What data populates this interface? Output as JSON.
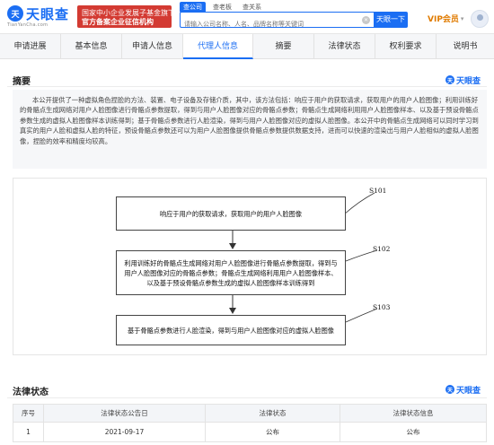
{
  "header": {
    "logo_mark": "天",
    "logo_text": "天眼查",
    "logo_sub": "TianYanCha.com",
    "gov_badge_line1": "国家中小企业发展子基金旗下",
    "gov_badge_line2": "官方备案企业征信机构",
    "search_tabs": [
      "查公司",
      "查老板",
      "查关系"
    ],
    "search_placeholder": "请输入公司名称、人名、品牌名称等关键词",
    "search_button": "天眼一下",
    "vip_label": "VIP会员",
    "vip_caret": "▾"
  },
  "tabs": [
    {
      "label": "申请进展"
    },
    {
      "label": "基本信息"
    },
    {
      "label": "申请人信息"
    },
    {
      "label": "代理人信息"
    },
    {
      "label": "摘要"
    },
    {
      "label": "法律状态"
    },
    {
      "label": "权利要求"
    },
    {
      "label": "说明书"
    }
  ],
  "abstract_section": {
    "title": "摘要",
    "brand": "天眼查",
    "text": "本公开提供了一种虚拟角色捏脸的方法、装置、电子设备及存储介质，其中，该方法包括：响应于用户的获取请求，获取用户的用户人脸图像；利用训练好的骨骼点生成网络对用户人脸图像进行骨骼点参数提取，得到与用户人脸图像对应的骨骼点参数；骨骼点生成网络利用用户人脸图像样本、以及基于预设骨骼点参数生成的虚拟人脸图像样本训练得到；基于骨骼点参数进行人脸渲染，得到与用户人脸图像对应的虚拟人脸图像。本公开中的骨骼点生成网络可以同时学习到真实的用户人脸和虚拟人脸的特征，预设骨骼点参数还可以为用户人脸图像提供骨骼点参数提供数据支持，进而可以快速的渲染出与用户人脸相似的虚拟人脸图像，捏脸的效率和精度均较高。"
  },
  "figure": {
    "steps": [
      {
        "id": "S101",
        "text": "响应于用户的获取请求，获取用户的用户人脸图像"
      },
      {
        "id": "S102",
        "text": "利用训练好的骨骼点生成网络对用户人脸图像进行骨骼点参数提取，得到与用户人脸图像对应的骨骼点参数；骨骼点生成网络利用用户人脸图像样本、以及基于预设骨骼点参数生成的虚拟人脸图像样本训练得到"
      },
      {
        "id": "S103",
        "text": "基于骨骼点参数进行人脸渲染，得到与用户人脸图像对应的虚拟人脸图像"
      }
    ]
  },
  "legal_section": {
    "title": "法律状态",
    "brand": "天眼查",
    "columns": [
      "序号",
      "法律状态公告日",
      "法律状态",
      "法律状态信息"
    ],
    "rows": [
      {
        "no": "1",
        "date": "2021-09-17",
        "status": "公布",
        "info": "公布"
      }
    ]
  },
  "colors": {
    "brand_blue": "#1b6ef3",
    "badge_red": "#d33a32",
    "vip_orange": "#e07b00"
  }
}
